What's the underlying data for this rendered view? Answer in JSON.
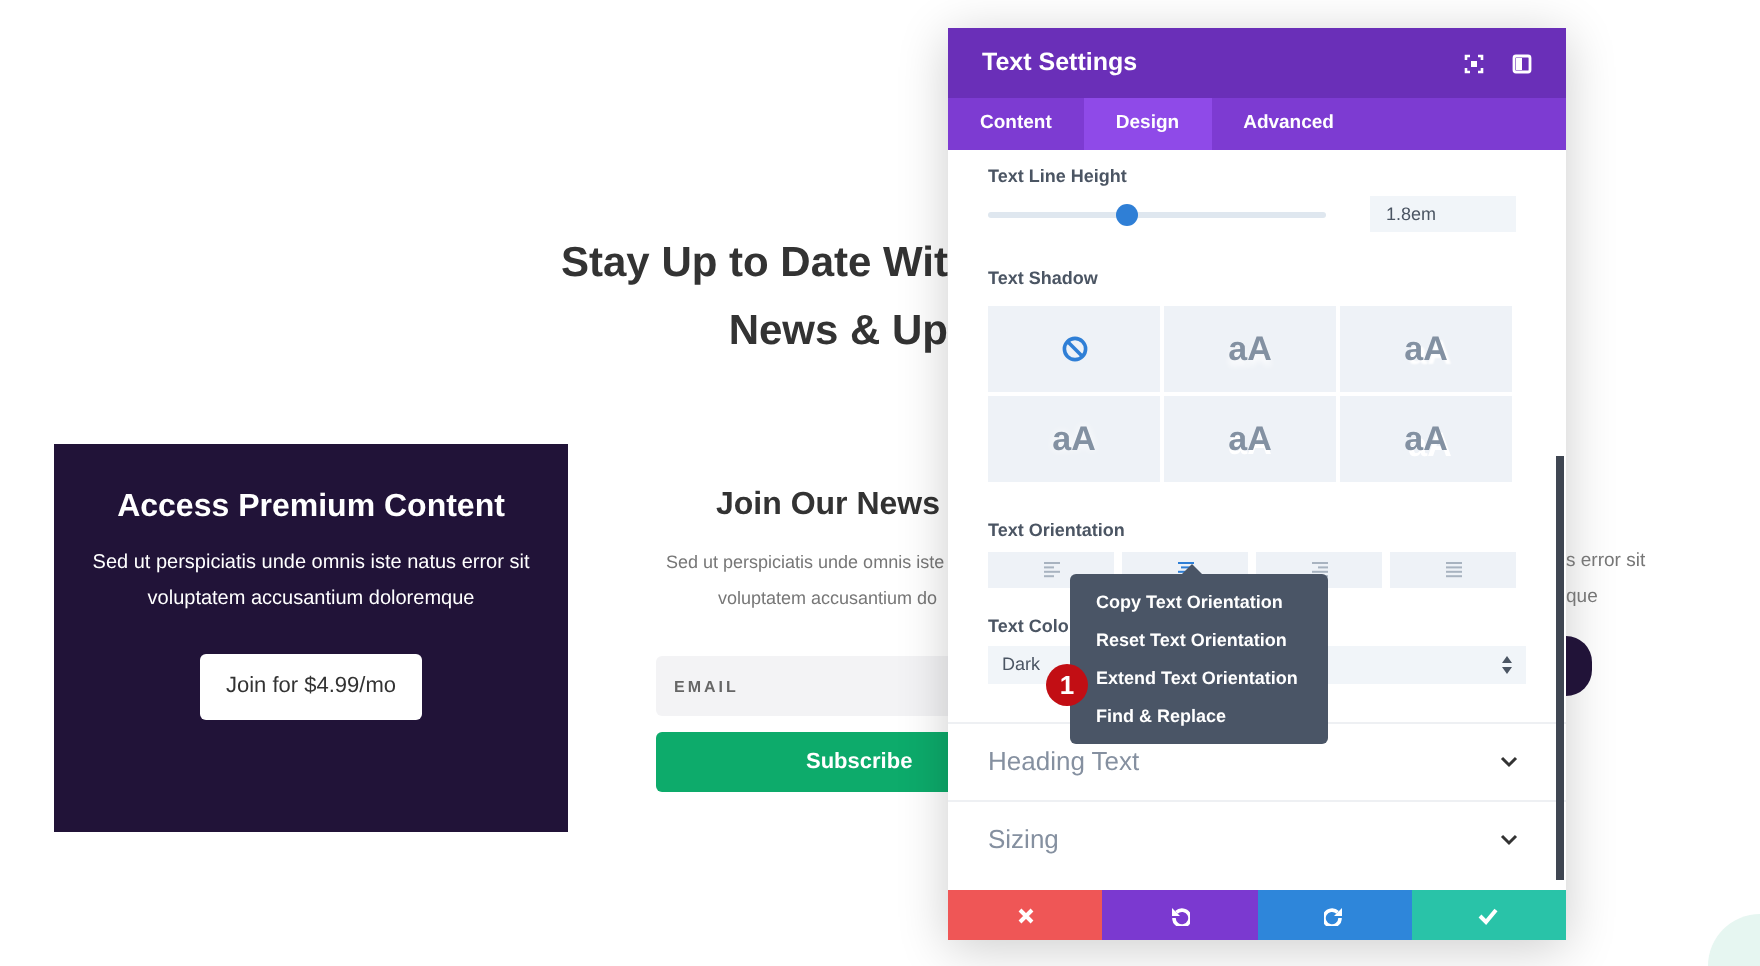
{
  "page": {
    "heading_lines": [
      "Stay Up to Date Wit",
      "News & Up"
    ],
    "premium_card": {
      "title": "Access Premium Content",
      "text": "Sed ut perspiciatis unde omnis iste natus error sit voluptatem accusantium doloremque",
      "button": "Join for $4.99/mo"
    },
    "newsletter": {
      "title": "Join Our News",
      "text_lines": [
        "Sed ut perspiciatis unde omnis iste",
        "voluptatem accusantium do"
      ],
      "email_placeholder": "EMAIL",
      "button": "Subscribe"
    },
    "right_column": {
      "text_lines": [
        "s error sit",
        "que"
      ]
    }
  },
  "settings_panel": {
    "title": "Text Settings",
    "tabs": [
      {
        "label": "Content",
        "selected": false
      },
      {
        "label": "Design",
        "selected": true
      },
      {
        "label": "Advanced",
        "selected": false
      }
    ],
    "line_height": {
      "label": "Text Line Height",
      "level": 0.41,
      "value": "1.8em"
    },
    "text_shadow": {
      "label": "Text Shadow",
      "presets": [
        {
          "kind": "none"
        },
        {
          "kind": "drop",
          "text": "aA"
        },
        {
          "kind": "offset",
          "text": "aA"
        },
        {
          "kind": "glow",
          "text": "aA"
        },
        {
          "kind": "outline",
          "text": "aA"
        },
        {
          "kind": "diagonal",
          "text": "aA"
        }
      ]
    },
    "text_orientation": {
      "label": "Text Orientation",
      "options": [
        {
          "kind": "left",
          "selected": false
        },
        {
          "kind": "center",
          "selected": true
        },
        {
          "kind": "right",
          "selected": false
        },
        {
          "kind": "justify",
          "selected": false
        }
      ]
    },
    "text_color": {
      "label": "Text Colo",
      "value": "Dark"
    },
    "context_menu": {
      "items": [
        "Copy Text Orientation",
        "Reset Text Orientation",
        "Extend Text Orientation",
        "Find & Replace"
      ]
    },
    "step_badge": "1",
    "sections": [
      {
        "title": "Heading Text",
        "expanded": false
      },
      {
        "title": "Sizing",
        "expanded": false
      }
    ]
  }
}
